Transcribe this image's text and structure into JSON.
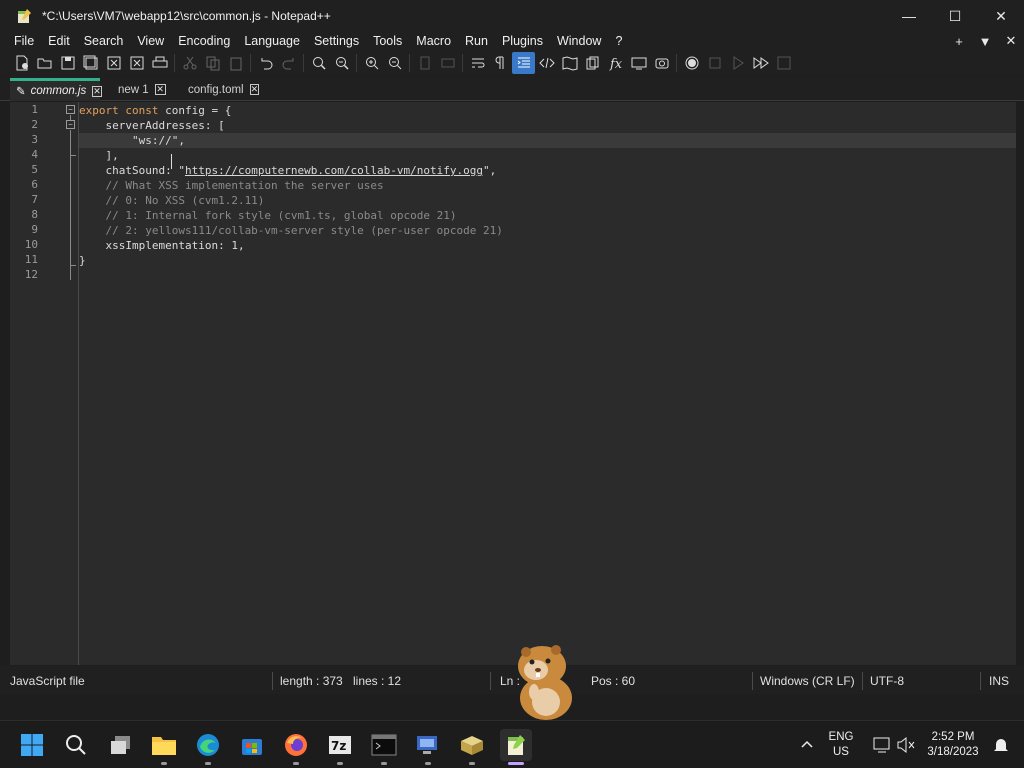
{
  "window": {
    "title": "*C:\\Users\\VM7\\webapp12\\src\\common.js - Notepad++",
    "minimize_glyph": "—",
    "maximize_glyph": "☐",
    "close_glyph": "✕"
  },
  "menu": {
    "items": [
      "File",
      "Edit",
      "Search",
      "View",
      "Encoding",
      "Language",
      "Settings",
      "Tools",
      "Macro",
      "Run",
      "Plugins",
      "Window",
      "?"
    ],
    "right": [
      "+",
      "▼",
      "✕"
    ]
  },
  "toolbar": {
    "icons": [
      "new-file-icon",
      "open-file-icon",
      "save-icon",
      "save-all-icon",
      "close-icon",
      "close-all-icon",
      "print-icon",
      "cut-icon",
      "copy-icon",
      "paste-icon",
      "undo-icon",
      "redo-icon",
      "find-icon",
      "replace-icon",
      "zoom-in-icon",
      "zoom-out-icon",
      "sync-vertical-icon",
      "sync-horizontal-icon",
      "word-wrap-icon",
      "show-all-chars-icon",
      "indent-guide-icon",
      "xml-tag-icon",
      "document-map-icon",
      "document-list-icon",
      "function-list-icon",
      "folder-workspace-icon",
      "monitoring-icon",
      "record-macro-icon",
      "stop-macro-icon",
      "play-macro-icon",
      "run-macro-multiple-icon",
      "save-macro-icon"
    ]
  },
  "tabs": [
    {
      "label": "common.js",
      "active": true,
      "close": "✕"
    },
    {
      "label": "new 1",
      "active": false,
      "close": "✕"
    },
    {
      "label": "config.toml",
      "active": false,
      "close": "✕"
    }
  ],
  "editor": {
    "line_numbers": [
      "1",
      "2",
      "3",
      "4",
      "5",
      "6",
      "7",
      "8",
      "9",
      "10",
      "11",
      "12"
    ],
    "lines": {
      "l1_kw1": "export",
      "l1_kw2": "const",
      "l1_rest": " config = {",
      "l2": "    serverAddresses: [",
      "l3": "        \"ws://\",",
      "l4": "    ],",
      "l5_key": "    chatSound: ",
      "l5_q1": "\"",
      "l5_url": "https://computernewb.com/collab-vm/notify.ogg",
      "l5_q2": "\",",
      "l6": "    // What XSS implementation the server uses",
      "l7": "    // 0: No XSS (cvm1.2.11)",
      "l8": "    // 1: Internal fork style (cvm1.ts, global opcode 21)",
      "l9": "    // 2: yellows111/collab-vm-server style (per-user opcode 21)",
      "l10": "    xssImplementation: 1,",
      "l11": "}",
      "l12": ""
    }
  },
  "status": {
    "file_type": "JavaScript file",
    "length": "length : 373",
    "lines": "lines : 12",
    "ln": "Ln :",
    "pos": "Pos : 60",
    "eol": "Windows (CR LF)",
    "encoding": "UTF-8",
    "mode": "INS"
  },
  "taskbar": {
    "icons": [
      "windows-start-icon",
      "search-icon",
      "task-view-icon",
      "file-explorer-icon",
      "edge-icon",
      "store-icon",
      "firefox-icon",
      "7zip-icon",
      "terminal-icon",
      "remote-desktop-icon",
      "package-icon",
      "notepadpp-icon"
    ],
    "chevron": "^",
    "lang_top": "ENG",
    "lang_bottom": "US",
    "time": "2:52 PM",
    "date": "3/18/2023"
  },
  "colors": {
    "accent_tab": "#35b08e",
    "change_marker": "#f08c1a",
    "keyword": "#e0a060",
    "active_toolbar": "#3a78c9"
  }
}
